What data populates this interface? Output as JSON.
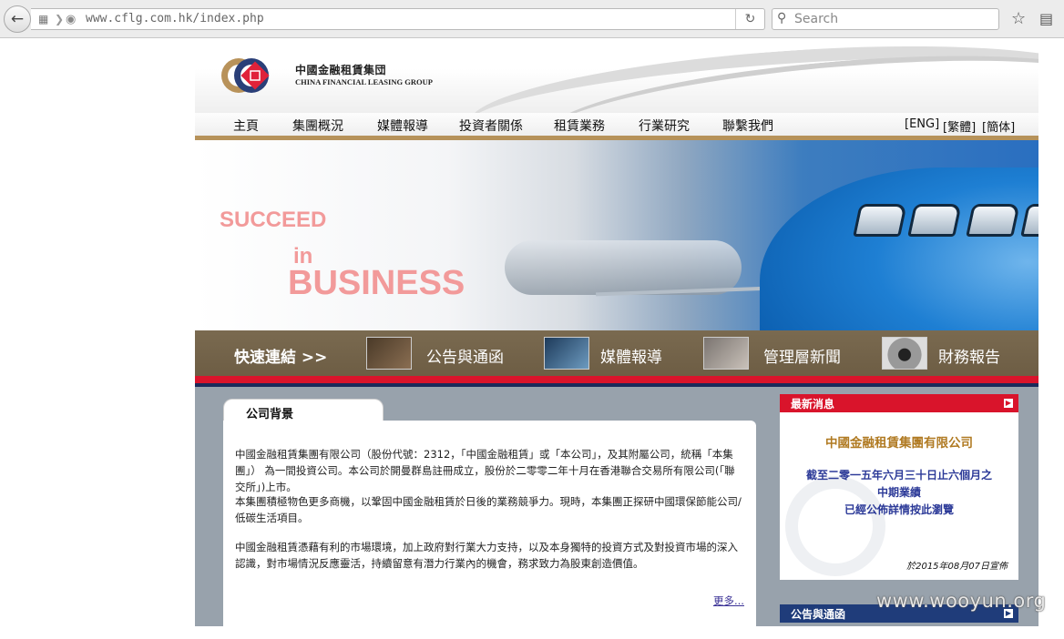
{
  "browser": {
    "url": "www.cflg.com.hk/index.php",
    "search_placeholder": "Search"
  },
  "header": {
    "company_cn": "中國金融租賃集団",
    "company_en": "CHINA FINANCIAL LEASING GROUP"
  },
  "nav": {
    "items": [
      "主頁",
      "集團概況",
      "媒體報導",
      "投資者關係",
      "租賃業務",
      "行業研究",
      "聯繫我們"
    ],
    "languages": [
      "[ENG]",
      "[繁體]",
      "[簡体]"
    ]
  },
  "banner": {
    "line1": "SUCCEED",
    "line2": "in",
    "line3": "BUSINESS"
  },
  "quick_links": {
    "title": "快速連結  >>",
    "items": [
      "公告與通函",
      "媒體報導",
      "管理層新聞",
      "財務報告"
    ]
  },
  "background": {
    "tab": "公司背景",
    "paragraphs": [
      "中國金融租賃集團有限公司（股份代號：2312，「中國金融租賃」或「本公司」，及其附屬公司，統稱「本集團」） 為一間投資公司。本公司於開曼群島註冊成立，股份於二零零二年十月在香港聯合交易所有限公司(「聯交所」)上市。",
      "本集團積極物色更多商機，以鞏固中國金融租賃於日後的業務競爭力。現時，本集團正探研中國環保節能公司/低碳生活項目。",
      "中國金融租賃憑藉有利的市場環境，加上政府對行業大力支持，以及本身獨特的投資方式及對投資市場的深入認識，對市場情況反應靈活，持續留意有潛力行業內的機會，務求致力為股東創造價值。"
    ],
    "more": "更多..."
  },
  "news": {
    "title": "最新消息",
    "company": "中國金融租賃集團有限公司",
    "lines": [
      "截至二零一五年六月三十日止六個月之",
      "中期業績",
      "已經公佈詳情按此瀏覽"
    ],
    "date": "於2015年08月07日宣佈"
  },
  "announcements": {
    "title": "公告與通函"
  },
  "watermark": "www.wooyun.org"
}
